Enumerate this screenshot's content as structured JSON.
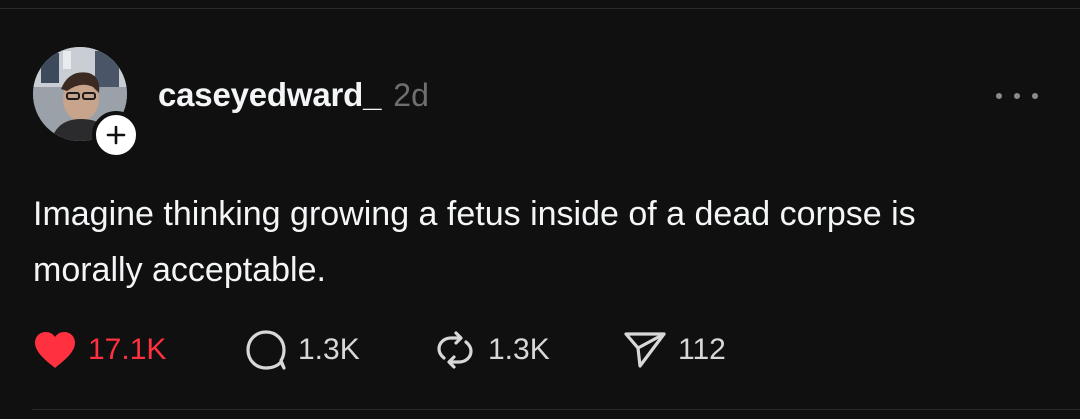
{
  "post": {
    "author": {
      "username": "caseyedward_",
      "avatar_icon": "user-photo",
      "follow_icon": "plus-icon"
    },
    "timestamp": "2d",
    "text": "Imagine thinking growing a fetus inside of a dead corpse is morally acceptable.",
    "more_icon": "ellipsis-icon",
    "actions": {
      "like": {
        "icon": "heart-icon",
        "count": "17.1K",
        "active": true,
        "color": "#ff3040"
      },
      "comment": {
        "icon": "comment-icon",
        "count": "1.3K"
      },
      "repost": {
        "icon": "repost-icon",
        "count": "1.3K"
      },
      "share": {
        "icon": "send-icon",
        "count": "112"
      }
    }
  },
  "theme": {
    "background": "#101010",
    "text": "#f3f5f7",
    "muted": "#6f6f6f",
    "like_red": "#ff3040"
  }
}
